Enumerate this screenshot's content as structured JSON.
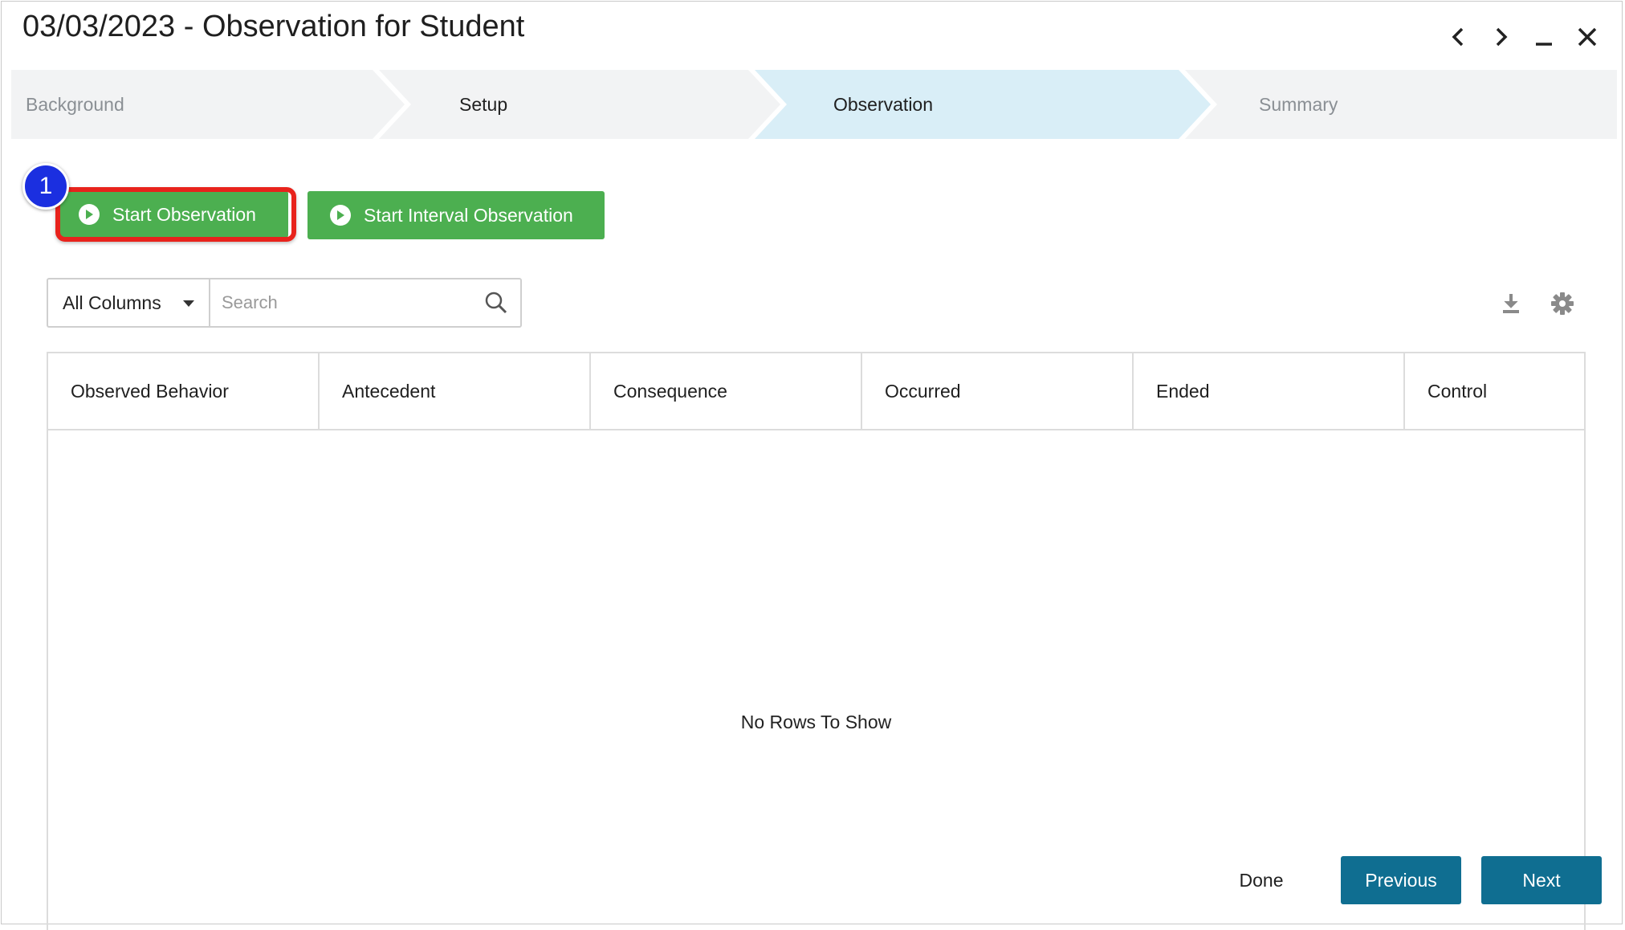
{
  "window": {
    "title": "03/03/2023 - Observation for Student",
    "controls": [
      "chevron-left-icon",
      "chevron-right-icon",
      "minimize-icon",
      "close-icon"
    ]
  },
  "stepper": {
    "steps": [
      {
        "label": "Background",
        "state": "completed"
      },
      {
        "label": "Setup",
        "state": "completed"
      },
      {
        "label": "Observation",
        "state": "active"
      },
      {
        "label": "Summary",
        "state": "upcoming"
      }
    ]
  },
  "actions": {
    "start_observation": "Start Observation",
    "start_interval_observation": "Start Interval Observation",
    "annotation_badge": "1"
  },
  "filter": {
    "column_select": "All Columns",
    "search_placeholder": "Search"
  },
  "grid": {
    "columns": [
      "Observed Behavior",
      "Antecedent",
      "Consequence",
      "Occurred",
      "Ended",
      "Control"
    ],
    "empty_message": "No Rows To Show"
  },
  "footer": {
    "done": "Done",
    "previous": "Previous",
    "next": "Next"
  },
  "colors": {
    "green": "#4caf50",
    "blue": "#0f6e91",
    "step_active": "#d9eef7",
    "step_default": "#f2f3f4",
    "highlight": "#e8231c",
    "badge": "#1b2fe0"
  }
}
